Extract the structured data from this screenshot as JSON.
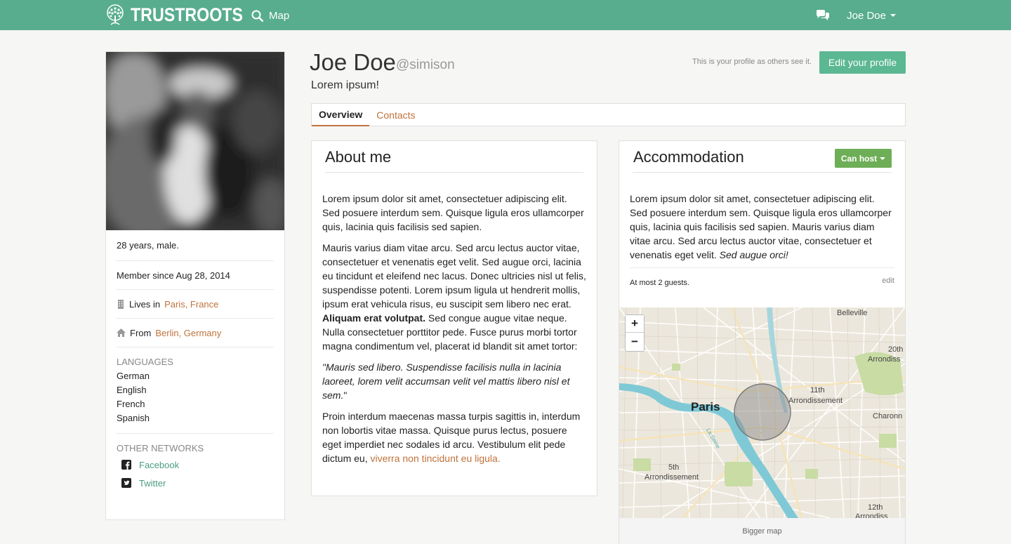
{
  "navbar": {
    "brand": "TRUSTROOTS",
    "map_label": "Map",
    "user_name": "Joe Doe"
  },
  "profile": {
    "name": "Joe Doe",
    "username": "@simison",
    "tagline": "Lorem ipsum!",
    "hint": "This is your profile as others see it.",
    "edit_button": "Edit your profile"
  },
  "tabs": [
    {
      "label": "Overview",
      "active": true
    },
    {
      "label": "Contacts",
      "active": false
    }
  ],
  "sidebar": {
    "age_gender": "28 years, male.",
    "member_since": "Member since Aug 28, 2014",
    "lives_prefix": "Lives in",
    "lives_place": "Paris, France",
    "from_prefix": "From",
    "from_place": "Berlin, Germany",
    "languages_title": "LANGUAGES",
    "languages": [
      "German",
      "English",
      "French",
      "Spanish"
    ],
    "networks_title": "OTHER NETWORKS",
    "networks": [
      "Facebook",
      "Twitter"
    ]
  },
  "about": {
    "title": "About me",
    "p1": "Lorem ipsum dolor sit amet, consectetuer adipiscing elit. Sed posuere interdum sem. Quisque ligula eros ullamcorper quis, lacinia quis facilisis sed sapien.",
    "p2_start": "Mauris varius diam vitae arcu. Sed arcu lectus auctor vitae, consectetuer et venenatis eget velit. Sed augue orci, lacinia eu tincidunt et eleifend nec lacus. Donec ultricies nisl ut felis, suspendisse potenti. Lorem ipsum ligula ut hendrerit mollis, ipsum erat vehicula risus, eu suscipit sem libero nec erat.",
    "p2_bold": "Aliquam erat volutpat.",
    "p2_end": "Sed congue augue vitae neque. Nulla consectetuer porttitor pede. Fusce purus morbi tortor magna condimentum vel, placerat id blandit sit amet tortor:",
    "quote_text": "\"Mauris sed libero. Suspendisse facilisis nulla in lacinia laoreet, lorem velit accumsan velit vel mattis libero nisl et sem.",
    "quote_close": "\"",
    "p4_start": "Proin interdum maecenas massa turpis sagittis in, interdum non lobortis vitae massa. Quisque purus lectus, posuere eget imperdiet nec sodales id arcu. Vestibulum elit pede dictum eu,",
    "p4_link": "viverra non tincidunt eu ligula."
  },
  "accommodation": {
    "title": "Accommodation",
    "status_button": "Can host",
    "text": "Lorem ipsum dolor sit amet, consectetuer adipiscing elit. Sed posuere interdum sem. Quisque ligula eros ullamcorper quis, lacinia quis facilisis sed sapien. Mauris varius diam vitae arcu. Sed arcu lectus auctor vitae, consectetuer et venenatis eget velit.",
    "text_italic": "Sed augue orci!",
    "guests": "At most 2 guests.",
    "edit": "edit"
  },
  "map": {
    "zoom_in": "+",
    "zoom_out": "−",
    "city": "Paris",
    "labels": {
      "belleville": "Belleville",
      "arr20_num": "20th",
      "arr20_word": "Arrondiss",
      "arr11_num": "11th",
      "arr11_word": "Arrondissement",
      "charonne": "Charonn",
      "arr5_num": "5th",
      "arr5_word": "Arrondissement",
      "arr12_num": "12th",
      "arr12_word": "Arrondiss",
      "seine": "La Seine"
    },
    "bigger_map": "Bigger map",
    "colors": {
      "land": "#ece7dc",
      "water": "#7fc9d6",
      "park": "#c8dca4",
      "circle": "#8c8c8c"
    }
  },
  "colors": {
    "navbar": "#58ad8f",
    "accent_brown": "#c0723c",
    "edit_button": "#5cb793",
    "can_host": "#6eae57"
  }
}
